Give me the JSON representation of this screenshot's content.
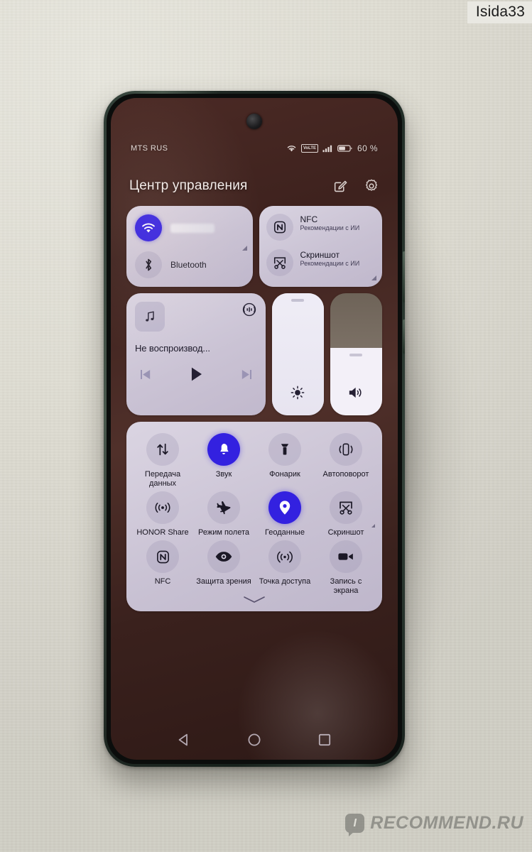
{
  "watermarks": {
    "top_right": "Isida33",
    "bottom_right_mark": "I",
    "bottom_right": "RECOMMEND.RU"
  },
  "status_bar": {
    "carrier": "MTS RUS",
    "volte_badge": "VoLTE",
    "battery_percent": "60 %",
    "icons": [
      "wifi-icon",
      "volte-icon",
      "signal-icon",
      "battery-icon"
    ]
  },
  "header": {
    "title": "Центр управления",
    "edit_icon": "edit-icon",
    "settings_icon": "gear-icon"
  },
  "toggles_card": {
    "wifi": {
      "label": "",
      "icon": "wifi-icon",
      "active": true,
      "ssid_redacted": true
    },
    "bluetooth": {
      "label": "Bluetooth",
      "icon": "bluetooth-icon",
      "active": false
    }
  },
  "suggestions_card": {
    "items": [
      {
        "title": "NFC",
        "subtitle": "Рекомендации с ИИ",
        "icon": "nfc-icon"
      },
      {
        "title": "Скриншот",
        "subtitle": "Рекомендации с ИИ",
        "icon": "screenshot-icon"
      }
    ]
  },
  "media_card": {
    "title": "Не воспроизвод...",
    "album_art_icon": "music-note-icon",
    "cast_icon": "cast-icon",
    "prev_icon": "previous-icon",
    "play_icon": "play-icon",
    "next_icon": "next-icon"
  },
  "sliders": {
    "brightness": {
      "icon": "brightness-icon",
      "value": 98
    },
    "volume": {
      "icon": "volume-icon",
      "value": 55
    }
  },
  "quick_toggles": [
    {
      "label": "Передача данных",
      "icon": "data-transfer-icon",
      "active": false,
      "expandable": false
    },
    {
      "label": "Звук",
      "icon": "bell-icon",
      "active": true,
      "expandable": false
    },
    {
      "label": "Фонарик",
      "icon": "flashlight-icon",
      "active": false,
      "expandable": false
    },
    {
      "label": "Автоповорот",
      "icon": "auto-rotate-icon",
      "active": false,
      "expandable": false
    },
    {
      "label": "HONOR Share",
      "icon": "honor-share-icon",
      "active": false,
      "expandable": false
    },
    {
      "label": "Режим полета",
      "icon": "airplane-icon",
      "active": false,
      "expandable": false
    },
    {
      "label": "Геоданные",
      "icon": "location-pin-icon",
      "active": true,
      "expandable": false
    },
    {
      "label": "Скриншот",
      "icon": "screenshot-icon",
      "active": false,
      "expandable": true
    },
    {
      "label": "NFC",
      "icon": "nfc-icon",
      "active": false,
      "expandable": false
    },
    {
      "label": "Защита зрения",
      "icon": "eye-comfort-icon",
      "active": false,
      "expandable": false
    },
    {
      "label": "Точка доступа",
      "icon": "hotspot-icon",
      "active": false,
      "expandable": false
    },
    {
      "label": "Запись с экрана",
      "icon": "screen-record-icon",
      "active": false,
      "expandable": false
    }
  ],
  "navigation_bar": {
    "back_icon": "back-triangle-icon",
    "home_icon": "home-circle-icon",
    "recents_icon": "recents-square-icon"
  },
  "colors": {
    "accent": "#3321e0",
    "panel": "#e0dced",
    "text": "#17141f",
    "frame": "#2c3a33"
  }
}
